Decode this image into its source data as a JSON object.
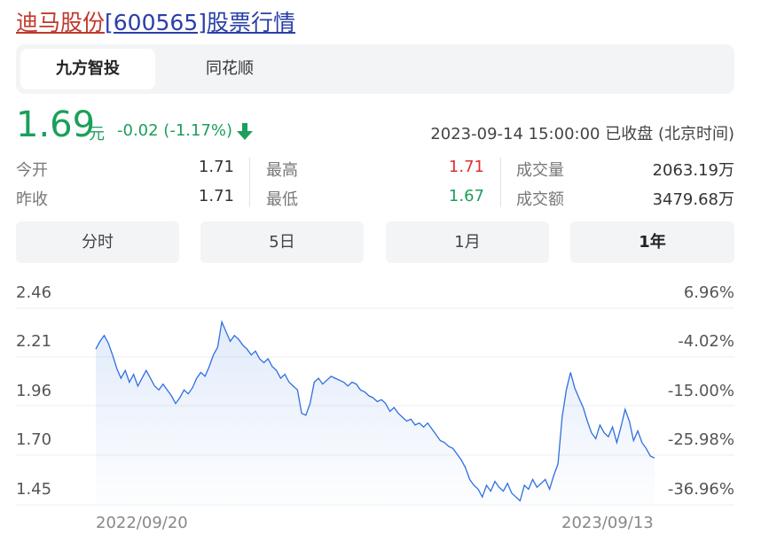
{
  "title": {
    "name": "迪马股份",
    "rest": "[600565]股票行情"
  },
  "sources": [
    {
      "label": "九方智投",
      "active": true
    },
    {
      "label": "同花顺",
      "active": false
    }
  ],
  "quote": {
    "price": "1.69",
    "unit": "元",
    "change": "-0.02 (-1.17%)",
    "time": "2023-09-14 15:00:00 已收盘 (北京时间)"
  },
  "stats": {
    "open_label": "今开",
    "open": "1.71",
    "prev_label": "昨收",
    "prev": "1.71",
    "high_label": "最高",
    "high": "1.71",
    "low_label": "最低",
    "low": "1.67",
    "vol_label": "成交量",
    "vol": "2063.19万",
    "amt_label": "成交额",
    "amt": "3479.68万"
  },
  "colors": {
    "up": "#e03030",
    "down": "#1aa05a",
    "line": "#2f6fe0"
  },
  "periods": [
    {
      "label": "分时",
      "active": false
    },
    {
      "label": "5日",
      "active": false
    },
    {
      "label": "1月",
      "active": false
    },
    {
      "label": "1年",
      "active": true
    }
  ],
  "chart_data": {
    "type": "area",
    "x_ticks": [
      "2022/09/20",
      "2023/09/13"
    ],
    "y_ticks": [
      "2.46",
      "2.21",
      "1.96",
      "1.70",
      "1.45"
    ],
    "y_ticks_right": [
      "6.96%",
      "-4.02%",
      "-15.00%",
      "-25.98%",
      "-36.96%"
    ],
    "ylim": [
      1.45,
      2.46
    ],
    "grid": true,
    "values": [
      2.25,
      2.29,
      2.32,
      2.28,
      2.22,
      2.15,
      2.1,
      2.14,
      2.08,
      2.12,
      2.06,
      2.1,
      2.14,
      2.1,
      2.06,
      2.04,
      2.07,
      2.04,
      2.01,
      1.97,
      2.0,
      2.04,
      2.02,
      2.05,
      2.1,
      2.13,
      2.11,
      2.16,
      2.22,
      2.26,
      2.39,
      2.34,
      2.29,
      2.32,
      2.3,
      2.27,
      2.25,
      2.22,
      2.24,
      2.2,
      2.18,
      2.2,
      2.16,
      2.14,
      2.1,
      2.12,
      2.08,
      2.06,
      2.04,
      1.92,
      1.91,
      1.97,
      2.08,
      2.1,
      2.07,
      2.09,
      2.11,
      2.1,
      2.09,
      2.08,
      2.06,
      2.08,
      2.07,
      2.04,
      2.03,
      2.01,
      2.0,
      1.98,
      1.99,
      1.97,
      1.93,
      1.95,
      1.92,
      1.9,
      1.88,
      1.89,
      1.86,
      1.87,
      1.85,
      1.87,
      1.84,
      1.81,
      1.78,
      1.77,
      1.75,
      1.74,
      1.71,
      1.68,
      1.64,
      1.58,
      1.55,
      1.53,
      1.49,
      1.55,
      1.52,
      1.57,
      1.54,
      1.52,
      1.56,
      1.51,
      1.49,
      1.47,
      1.55,
      1.53,
      1.58,
      1.54,
      1.56,
      1.58,
      1.53,
      1.6,
      1.66,
      1.9,
      2.04,
      2.13,
      2.05,
      2.0,
      1.95,
      1.88,
      1.82,
      1.79,
      1.86,
      1.82,
      1.8,
      1.85,
      1.77,
      1.85,
      1.94,
      1.88,
      1.78,
      1.83,
      1.77,
      1.74,
      1.7,
      1.69
    ]
  }
}
